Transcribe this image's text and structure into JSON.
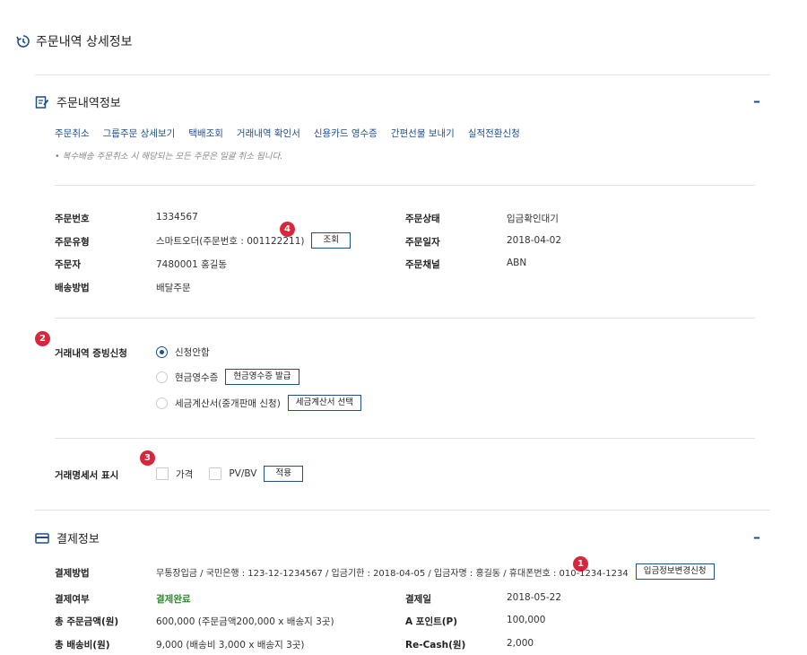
{
  "page_title": "주문내역 상세정보",
  "order_section": {
    "title": "주문내역정보",
    "collapse": "–",
    "links": [
      "주문취소",
      "그룹주문 상세보기",
      "택배조회",
      "거래내역 확인서",
      "신용카드 영수증",
      "간편선물 보내기",
      "실적전환신청"
    ],
    "note": "• 복수배송 주문취소 시 해당되는 모든 주문은 일괄 취소 됩니다.",
    "fields": {
      "order_no_label": "주문번호",
      "order_no": "1334567",
      "order_type_label": "주문유형",
      "order_type": "스마트오더(주문번호 : 001122211)",
      "lookup_button": "조회",
      "orderer_label": "주문자",
      "orderer": "7480001 홍길동",
      "delivery_label": "배송방법",
      "delivery": "배달주문",
      "status_label": "주문상태",
      "status": "입금확인대기",
      "date_label": "주문일자",
      "date": "2018-04-02",
      "channel_label": "주문채널",
      "channel": "ABN"
    }
  },
  "badges": [
    "1",
    "2",
    "3",
    "4"
  ],
  "proof": {
    "label": "거래내역 증빙신청",
    "options": [
      {
        "label": "신청안함",
        "checked": true
      },
      {
        "label": "현금영수증",
        "button": "현금영수증 발급"
      },
      {
        "label": "세금계산서(중개판매 신청)",
        "button": "세금계산서 선택"
      }
    ]
  },
  "statement": {
    "label": "거래명세서 표시",
    "price": "가격",
    "pvbv": "PV/BV",
    "apply": "적용"
  },
  "payment_section": {
    "title": "결제정보",
    "collapse": "–",
    "method_label": "결제방법",
    "method": "무통장입금 / 국민은행 : 123-12-1234567 / 입금기한 : 2018-04-05 / 입금자명 : 홍길동 / 휴대폰번호 : 010-1234-1234",
    "change_button": "입금정보변경신청",
    "paid_label": "결제여부",
    "paid": "결제완료",
    "pay_date_label": "결제일",
    "pay_date": "2018-05-22",
    "total_label": "총 주문금액(원)",
    "total": "600,000 (주문금액200,000 x 배송지 3곳)",
    "point_label": "A 포인트(P)",
    "point": "100,000",
    "ship_label": "총 배송비(원)",
    "ship": "9,000 (배송비 3,000 x 배송지 3곳)",
    "recash_label": "Re-Cash(원)",
    "recash": "2,000"
  }
}
